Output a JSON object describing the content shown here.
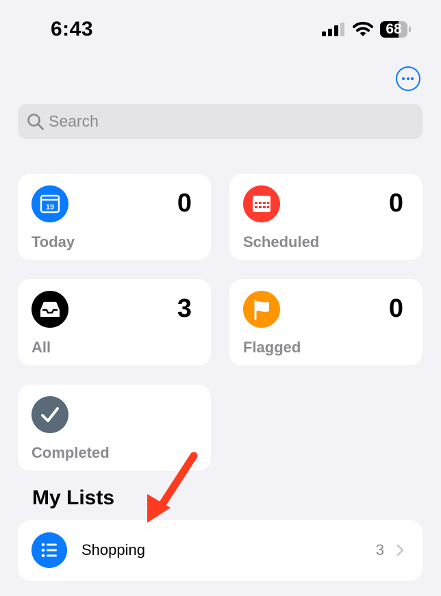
{
  "status_bar": {
    "time": "6:43",
    "battery_level": "68",
    "battery_fraction": 0.68,
    "signal_bars_active": 3,
    "signal_bars_total": 4
  },
  "header": {
    "more_icon": "ellipsis-circle-icon"
  },
  "search": {
    "placeholder": "Search",
    "icon": "magnifying-glass-icon"
  },
  "smart_lists": [
    {
      "key": "today",
      "label": "Today",
      "count": "0",
      "icon": "calendar-icon",
      "color": "#0a7aff",
      "day": "19"
    },
    {
      "key": "scheduled",
      "label": "Scheduled",
      "count": "0",
      "icon": "calendar-grid-icon",
      "color": "#ff3b30"
    },
    {
      "key": "all",
      "label": "All",
      "count": "3",
      "icon": "tray-icon",
      "color": "#000000"
    },
    {
      "key": "flagged",
      "label": "Flagged",
      "count": "0",
      "icon": "flag-icon",
      "color": "#ff9500"
    },
    {
      "key": "completed",
      "label": "Completed",
      "icon": "checkmark-icon",
      "color": "#5a6a78"
    }
  ],
  "my_lists": {
    "title": "My Lists",
    "items": [
      {
        "name": "Shopping",
        "count": "3",
        "icon": "list-bullet-icon",
        "color": "#0a7aff"
      }
    ]
  },
  "annotation": {
    "color": "#ff3b1f",
    "icon": "red-arrow-icon"
  }
}
